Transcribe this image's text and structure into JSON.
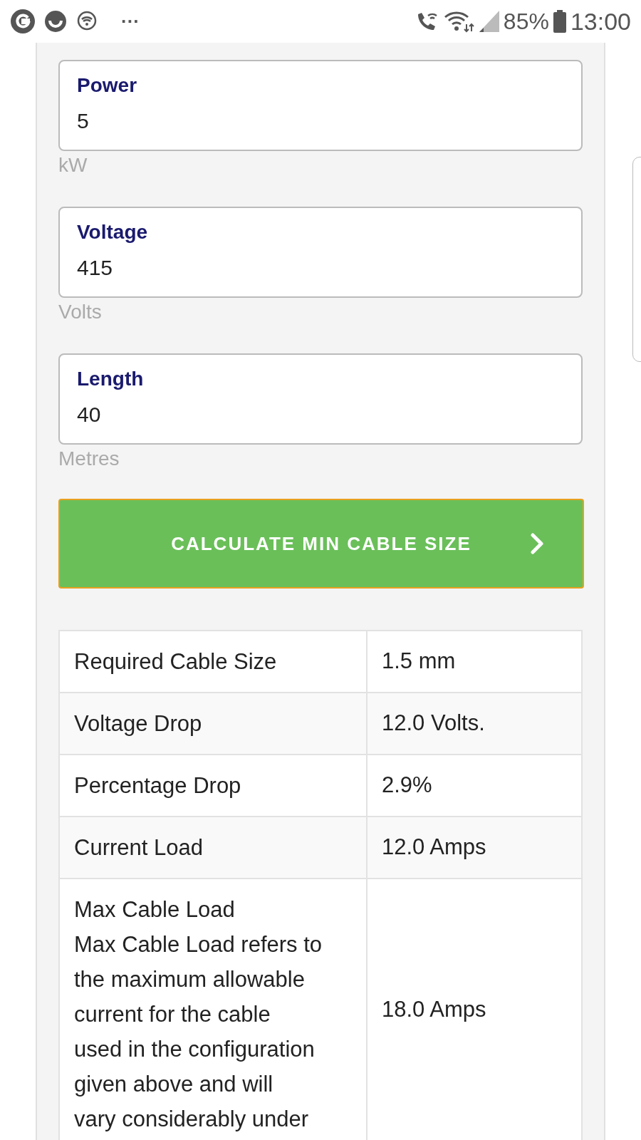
{
  "status_bar": {
    "battery": "85%",
    "time": "13:00",
    "more": "···"
  },
  "fields": [
    {
      "label": "Power",
      "value": "5",
      "unit": "kW"
    },
    {
      "label": "Voltage",
      "value": "415",
      "unit": "Volts"
    },
    {
      "label": "Length",
      "value": "40",
      "unit": "Metres"
    }
  ],
  "button": {
    "label": "CALCULATE MIN CABLE SIZE"
  },
  "results": [
    {
      "name": "Required Cable Size",
      "value": "1.5 mm"
    },
    {
      "name": "Voltage Drop",
      "value": "12.0 Volts."
    },
    {
      "name": "Percentage Drop",
      "value": "2.9%"
    },
    {
      "name": "Current Load",
      "value": "12.0 Amps"
    },
    {
      "name": "Max Cable Load",
      "note": "Max Cable Load refers to\nthe maximum allowable\ncurrent for the cable\nused in the configuration\ngiven above and will\nvary considerably under",
      "value": "18.0 Amps"
    }
  ]
}
